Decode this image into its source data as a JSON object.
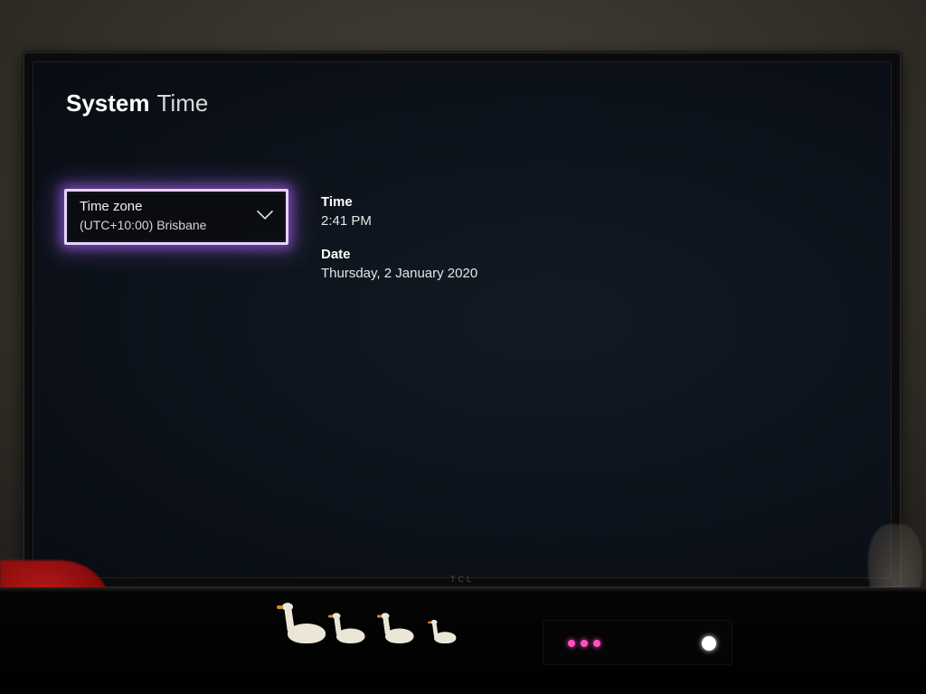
{
  "breadcrumb": {
    "section": "System",
    "page": "Time"
  },
  "timezone_option": {
    "label": "Time zone",
    "selected": "(UTC+10:00) Brisbane"
  },
  "time": {
    "heading": "Time",
    "value": "2:41 PM"
  },
  "date": {
    "heading": "Date",
    "value": "Thursday, 2 January 2020"
  },
  "tv_brand": "TCL"
}
